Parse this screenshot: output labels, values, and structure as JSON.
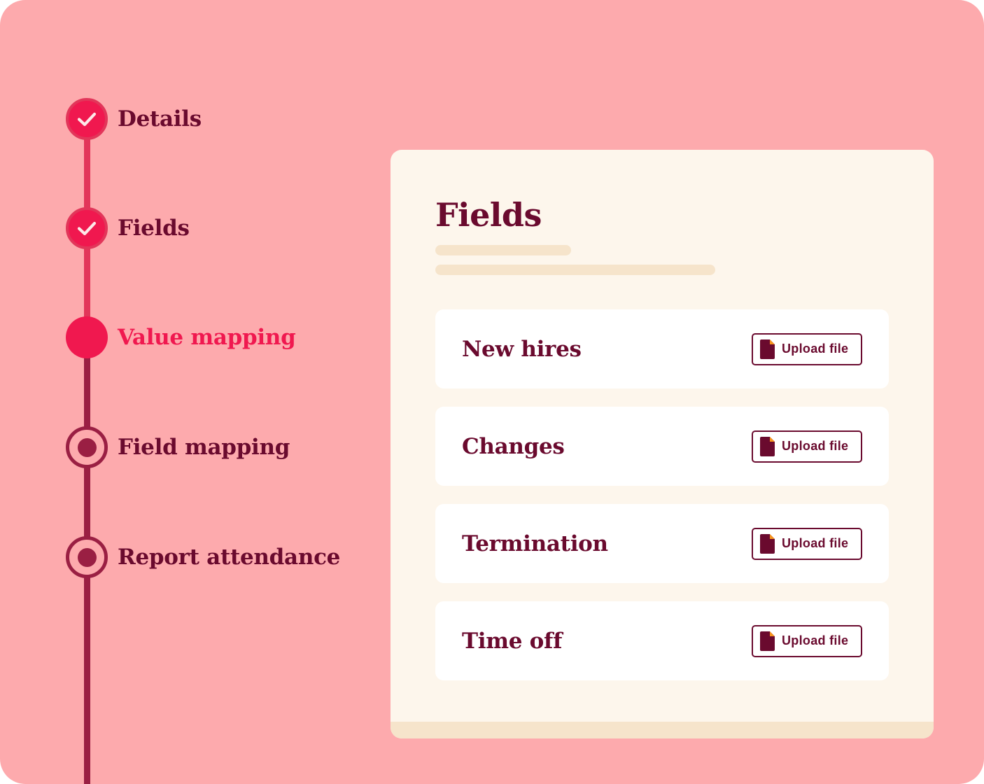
{
  "colors": {
    "background": "#fdaaad",
    "accent": "#f0184f",
    "completed_track": "#e2365a",
    "upcoming_track": "#9a1f43",
    "text_dark": "#6a0a2e",
    "card_background": "#fdf6ec",
    "card_footer": "#f6e4cb",
    "row_background": "#ffffff",
    "file_icon_corner": "#f7941d"
  },
  "stepper": {
    "steps": [
      {
        "label": "Details",
        "state": "completed",
        "icon": "check-icon"
      },
      {
        "label": "Fields",
        "state": "completed",
        "icon": "check-icon"
      },
      {
        "label": "Value mapping",
        "state": "current",
        "icon": ""
      },
      {
        "label": "Field mapping",
        "state": "upcoming",
        "icon": "dot-icon"
      },
      {
        "label": "Report attendance",
        "state": "upcoming",
        "icon": "dot-icon"
      }
    ]
  },
  "card": {
    "title": "Fields",
    "rows": [
      {
        "title": "New hires",
        "button_label": "Upload file",
        "button_icon": "file-icon"
      },
      {
        "title": "Changes",
        "button_label": "Upload file",
        "button_icon": "file-icon"
      },
      {
        "title": "Termination",
        "button_label": "Upload file",
        "button_icon": "file-icon"
      },
      {
        "title": "Time off",
        "button_label": "Upload file",
        "button_icon": "file-icon"
      }
    ]
  }
}
